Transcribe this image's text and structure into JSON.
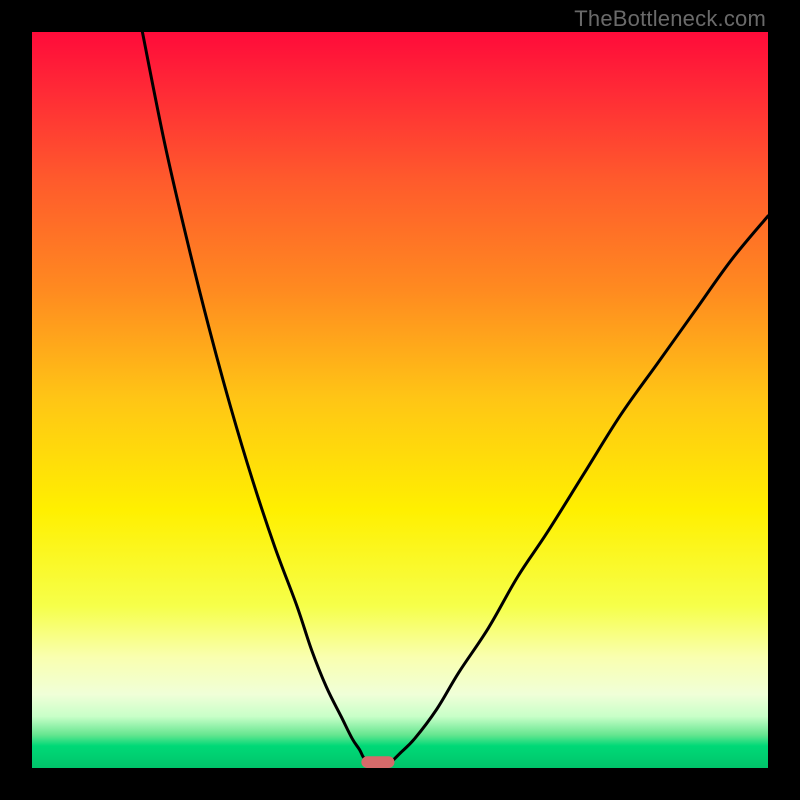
{
  "watermark": "TheBottleneck.com",
  "colors": {
    "frame_bg": "#000000",
    "curve_stroke": "#000000",
    "marker_fill": "#d66a6a",
    "gradient_stops": [
      {
        "offset": 0.0,
        "color": "#ff0b3a"
      },
      {
        "offset": 0.08,
        "color": "#ff2a36"
      },
      {
        "offset": 0.2,
        "color": "#ff5a2c"
      },
      {
        "offset": 0.35,
        "color": "#ff8a20"
      },
      {
        "offset": 0.5,
        "color": "#ffc615"
      },
      {
        "offset": 0.65,
        "color": "#fff000"
      },
      {
        "offset": 0.78,
        "color": "#f6ff4a"
      },
      {
        "offset": 0.85,
        "color": "#f9ffb0"
      },
      {
        "offset": 0.9,
        "color": "#f0ffd8"
      },
      {
        "offset": 0.93,
        "color": "#c8ffc8"
      },
      {
        "offset": 0.955,
        "color": "#66e690"
      },
      {
        "offset": 0.97,
        "color": "#00d977"
      },
      {
        "offset": 1.0,
        "color": "#00c46a"
      }
    ]
  },
  "chart_data": {
    "type": "line",
    "title": "",
    "xlabel": "",
    "ylabel": "",
    "xlim": [
      0,
      100
    ],
    "ylim": [
      0,
      100
    ],
    "legend": false,
    "grid": false,
    "series": [
      {
        "name": "left-branch",
        "x": [
          15,
          18,
          21,
          24,
          27,
          30,
          33,
          36,
          38,
          40,
          42,
          43.5,
          44.5,
          45,
          45.5
        ],
        "values": [
          100,
          85,
          72,
          60,
          49,
          39,
          30,
          22,
          16,
          11,
          7,
          4,
          2.5,
          1.5,
          1
        ]
      },
      {
        "name": "right-branch",
        "x": [
          49,
          50,
          52,
          55,
          58,
          62,
          66,
          70,
          75,
          80,
          85,
          90,
          95,
          100
        ],
        "values": [
          1,
          2,
          4,
          8,
          13,
          19,
          26,
          32,
          40,
          48,
          55,
          62,
          69,
          75
        ]
      }
    ],
    "annotations": [
      {
        "name": "minimum-marker",
        "shape": "rounded-bar",
        "x_center": 47,
        "y": 0.8,
        "width": 4.5,
        "height": 1.6
      }
    ]
  }
}
